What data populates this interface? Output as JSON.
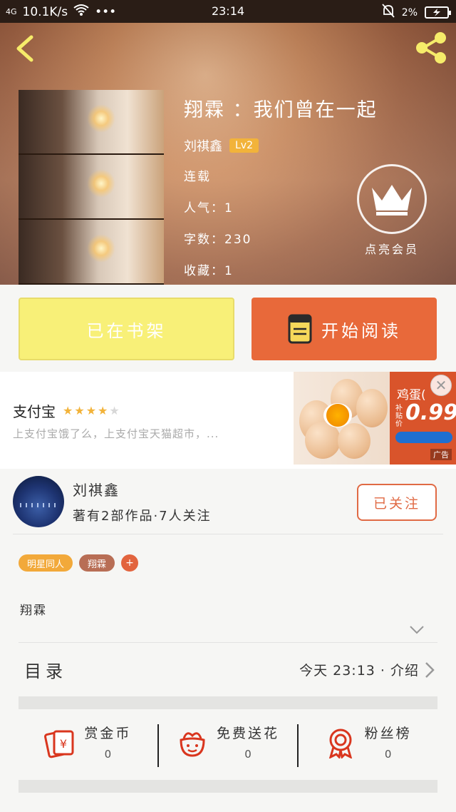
{
  "status_bar": {
    "network": "4G",
    "speed": "10.1K/s",
    "time": "23:14",
    "battery": "2%"
  },
  "book": {
    "title": "翔霖 ：我们曾在一起",
    "author": "刘祺鑫",
    "level": "Lv2",
    "status": "连载",
    "popularity": "人气：1",
    "word_count": "字数：230",
    "favorites": "收藏：1"
  },
  "vip": {
    "label": "点亮会员"
  },
  "buttons": {
    "shelf": "已在书架",
    "read": "开始阅读"
  },
  "ad": {
    "title": "支付宝",
    "rating": 4,
    "rating_max": 5,
    "description": "上支付宝饿了么，上支付宝天猫超市，...",
    "image_product": "鸡蛋(",
    "image_price": "0.99",
    "image_price_label": "补贴价",
    "tag": "广告",
    "close": "✕"
  },
  "author_card": {
    "name": "刘祺鑫",
    "stats": "著有2部作品·7人关注",
    "follow_label": "已关注"
  },
  "tags": [
    "明星同人",
    "翔霖",
    "+"
  ],
  "description": "翔霖",
  "toc": {
    "label": "目录",
    "info": "今天 23:13 · 介绍"
  },
  "actions": [
    {
      "label": "赏金币",
      "count": "0",
      "icon": "red-envelope-icon"
    },
    {
      "label": "免费送花",
      "count": "0",
      "icon": "flower-icon"
    },
    {
      "label": "粉丝榜",
      "count": "0",
      "icon": "medal-icon"
    }
  ],
  "colors": {
    "accent_orange": "#e8693a",
    "shelf_yellow": "#f8f078",
    "level_badge": "#f2b33a",
    "icon_red": "#d9361e"
  }
}
